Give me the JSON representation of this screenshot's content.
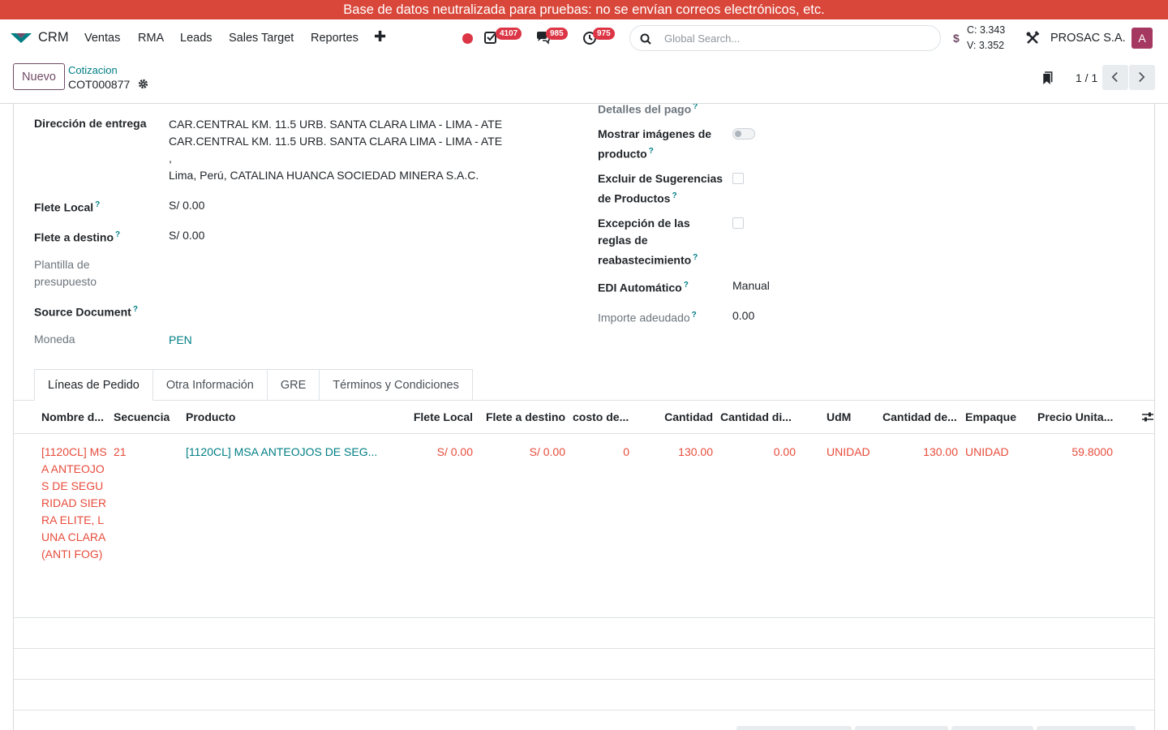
{
  "banner": {
    "text": "Base de datos neutralizada para pruebas: no se envían correos electrónicos, etc."
  },
  "navbar": {
    "app_name": "CRM",
    "menu": [
      "Ventas",
      "RMA",
      "Leads",
      "Sales Target",
      "Reportes"
    ],
    "badges": {
      "activities": "4107",
      "messages": "985",
      "clock": "975"
    },
    "search_placeholder": "Global Search...",
    "currency_symbol": "$",
    "rate_buy": "C: 3.343",
    "rate_sell": "V: 3.352",
    "company": "PROSAC S.A.",
    "avatar_letter": "A"
  },
  "control": {
    "new_label": "Nuevo",
    "breadcrumb_parent": "Cotizacion",
    "breadcrumb_current": "COT000877",
    "pager": "1 / 1"
  },
  "form": {
    "left": {
      "delivery_label": "Dirección de entrega",
      "delivery_lines": [
        "CAR.CENTRAL KM. 11.5 URB. SANTA CLARA LIMA - LIMA - ATE",
        "CAR.CENTRAL KM. 11.5 URB. SANTA CLARA LIMA - LIMA - ATE",
        ",",
        "Lima, Perú, CATALINA HUANCA SOCIEDAD MINERA S.A.C."
      ],
      "flete_local_label": "Flete Local",
      "flete_local_value": "S/ 0.00",
      "flete_destino_label": "Flete a destino",
      "flete_destino_value": "S/ 0.00",
      "plantilla_label_1": "Plantilla de",
      "plantilla_label_2": "presupuesto",
      "source_label": "Source Document",
      "moneda_label": "Moneda",
      "moneda_value": "PEN"
    },
    "right": {
      "pago_label": "Detalles del pago",
      "mostrar_label_1": "Mostrar imágenes de",
      "mostrar_label_2": "producto",
      "excluir_label_1": "Excluir de Sugerencias",
      "excluir_label_2": "de Productos",
      "excepcion_label_1": "Excepción de las",
      "excepcion_label_2": "reglas de",
      "excepcion_label_3": "reabastecimiento",
      "edi_label": "EDI Automático",
      "edi_value": "Manual",
      "importe_label": "Importe adeudado",
      "importe_value": "0.00"
    },
    "help_mark": "?"
  },
  "tabs": [
    "Líneas de Pedido",
    "Otra Información",
    "GRE",
    "Términos y Condiciones"
  ],
  "order_lines": {
    "columns": [
      "Nombre d...",
      "Secuencia",
      "Producto",
      "Flete Local",
      "Flete a destino",
      "costo de...",
      "Cantidad",
      "Cantidad di...",
      "UdM",
      "Cantidad de...",
      "Empaque",
      "Precio Unita..."
    ],
    "rows": [
      {
        "name": "[1120CL] MSA ANTEOJOS DE SEGURIDAD SIERRA ELITE, LUNA CLARA(ANTI FOG)",
        "sequence": "21",
        "product": "[1120CL] MSA ANTEOJOS DE SEG...",
        "flete_local": "S/ 0.00",
        "flete_destino": "S/ 0.00",
        "costo": "0",
        "cantidad": "130.00",
        "cantidad_disp": "0.00",
        "udm": "UNIDAD",
        "cantidad_de": "130.00",
        "empaque": "UNIDAD",
        "precio": "59.8000"
      }
    ]
  },
  "colors": {
    "brand": "#714b67",
    "link": "#017e84",
    "danger": "#e74c3c",
    "banner": "#d9473a"
  },
  "icons": [
    "app-logo-icon",
    "plus-icon",
    "record-dot-icon",
    "activity-check-icon",
    "chat-icon",
    "clock-icon",
    "search-icon",
    "tools-icon",
    "gear-icon",
    "bookmark-icon",
    "chevron-left-icon",
    "chevron-right-icon",
    "column-settings-icon"
  ]
}
